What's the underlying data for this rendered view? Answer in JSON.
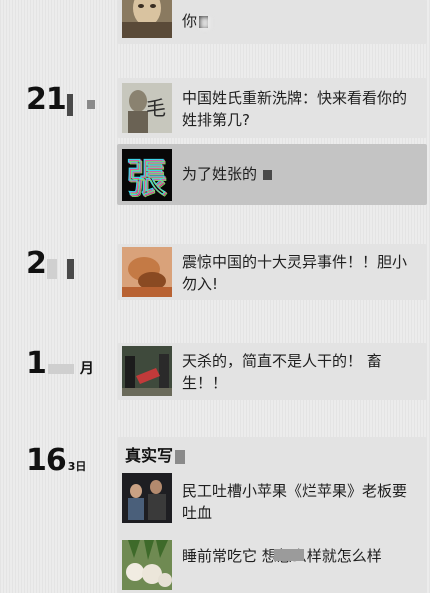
{
  "feed": {
    "groups": [
      {
        "day": "21",
        "month": "",
        "articles": [
          {
            "title": "中国姓氏重新洗牌：快来看看你的姓排第几?",
            "thumb_icon": "mao-surname-thumbnail"
          },
          {
            "title": "为了姓张的",
            "thumb_icon": "zhang-character-thumbnail"
          }
        ]
      },
      {
        "day": "2",
        "month": "",
        "articles": [
          {
            "title": "震惊中国的十大灵异事件！！胆小勿入!",
            "thumb_icon": "fallen-figure-thumbnail"
          }
        ]
      },
      {
        "day": "1",
        "month": "月",
        "articles": [
          {
            "title": "天杀的，简直不是人干的！ 畜生！！",
            "thumb_icon": "street-crowd-thumbnail"
          }
        ]
      },
      {
        "day": "16",
        "month": "3日",
        "section_title": "真实写",
        "articles": [
          {
            "title": "民工吐槽小苹果《烂苹果》老板要吐血",
            "thumb_icon": "workers-photo-thumbnail"
          },
          {
            "title": "睡前常吃它 想怎么样就怎么样",
            "thumb_icon": "vegetables-thumbnail"
          }
        ]
      }
    ],
    "top_partial": {
      "title": "你",
      "thumb_icon": "portrait-thumbnail"
    }
  },
  "colors": {
    "background": "#ececec",
    "card": "#e3e3e3",
    "card_active": "#c4c4c4",
    "text": "#1f1f1f"
  }
}
